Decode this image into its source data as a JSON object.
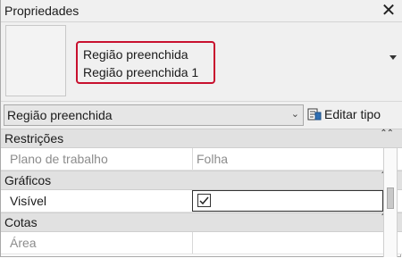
{
  "window": {
    "title": "Propriedades",
    "close_glyph": "✕"
  },
  "type_selector": {
    "family": "Região preenchida",
    "type": "Região preenchida 1",
    "highlight_color": "#c8102e"
  },
  "filter": {
    "selected": "Região preenchida",
    "chevron": "⌄",
    "edit_type_label": "Editar tipo",
    "edit_type_icon": "edit-type-icon"
  },
  "categories": [
    {
      "label": "Restrições",
      "collapse_glyph": "⌃⌃",
      "properties": [
        {
          "name": "Plano de trabalho",
          "value": "Folha",
          "editable": false
        }
      ]
    },
    {
      "label": "Gráficos",
      "collapse_glyph": "⌃⌃",
      "properties": [
        {
          "name": "Visível",
          "value": "checked",
          "editable": true
        }
      ]
    },
    {
      "label": "Cotas",
      "collapse_glyph": "⌃⌃",
      "properties": [
        {
          "name": "Área",
          "value": "",
          "editable": false
        }
      ]
    }
  ],
  "colors": {
    "panel_bg": "#f0f0f0",
    "category_bg": "#e1e1e1",
    "disabled_text": "#8c8c8c"
  }
}
